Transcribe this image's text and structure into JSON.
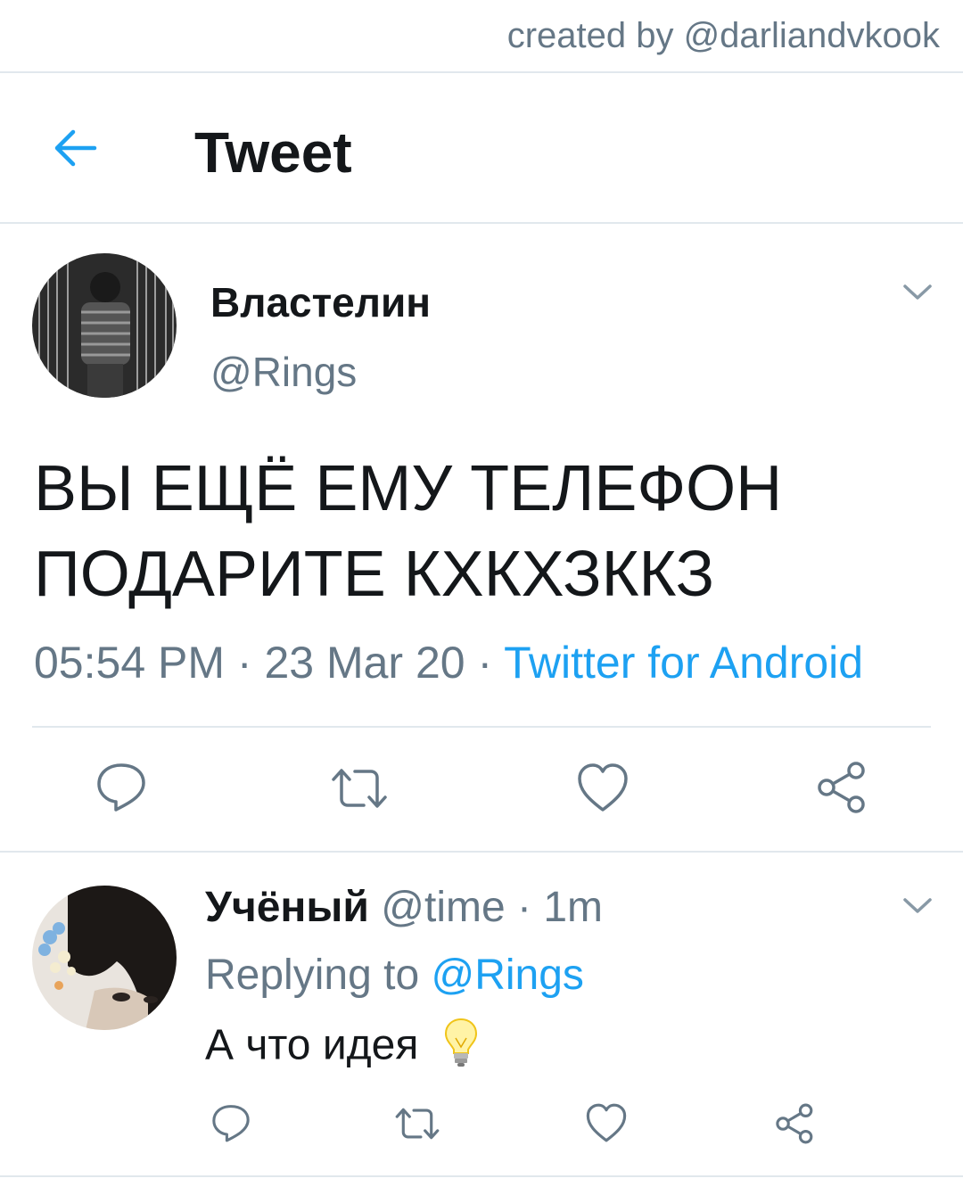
{
  "watermark": "created by @darliandvkook",
  "header": {
    "title": "Tweet",
    "back_icon": "back-arrow-icon"
  },
  "tweet": {
    "author_name": "Властелин",
    "author_handle": "@Rings",
    "text": "ВЫ ЕЩЁ ЕМУ ТЕЛЕФОН ПОДАРИТЕ КХКХЗККЗ",
    "time": "05:54 PM",
    "sep1": " · ",
    "date": "23 Mar 20",
    "sep2": " · ",
    "source": "Twitter for Android",
    "actions": [
      "reply-icon",
      "retweet-icon",
      "like-icon",
      "share-icon"
    ]
  },
  "reply": {
    "author_name": "Учёный",
    "author_handle": " @time · 1m",
    "replying_prefix": "Replying to ",
    "replying_mention": "@Rings",
    "text": "А что идея",
    "emoji_icon": "lightbulb-icon",
    "actions": [
      "reply-icon",
      "retweet-icon",
      "like-icon",
      "share-icon"
    ]
  },
  "colors": {
    "accent": "#1da1f2",
    "secondary_text": "#657786",
    "divider": "#e1e8ed"
  }
}
